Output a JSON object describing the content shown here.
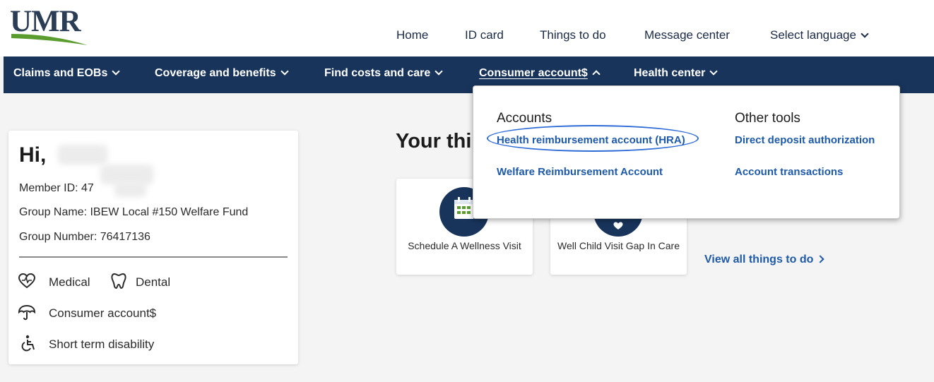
{
  "brand": {
    "logo_text": "UMR",
    "navy": "#18345b",
    "green": "#5a9c2e",
    "link_blue": "#1e5aa8"
  },
  "top_nav": {
    "home": "Home",
    "id_card": "ID card",
    "things_to_do": "Things to do",
    "message_center": "Message center",
    "select_language": "Select language"
  },
  "main_nav": {
    "claims": "Claims and EOBs",
    "coverage": "Coverage and benefits",
    "find_costs": "Find costs and care",
    "consumer_account": "Consumer account$",
    "health_center": "Health center"
  },
  "dropdown": {
    "accounts_heading": "Accounts",
    "hra": "Health reimbursement account (HRA)",
    "welfare": "Welfare Reimbursement Account",
    "other_tools_heading": "Other tools",
    "direct_deposit": "Direct deposit authorization",
    "account_transactions": "Account transactions"
  },
  "member": {
    "greeting": "Hi,",
    "member_id": "Member ID: 47",
    "group_name": "Group Name: IBEW Local #150 Welfare Fund",
    "group_number": "Group Number: 76417136"
  },
  "benefits": {
    "medical": "Medical",
    "dental": "Dental",
    "consumer_account": "Consumer account$",
    "short_term_disability": "Short term disability"
  },
  "things": {
    "title": "Your thi",
    "wellness_visit": "Schedule A Wellness Visit",
    "well_child": "Well Child Visit Gap In Care",
    "view_all": "View all things to do"
  }
}
